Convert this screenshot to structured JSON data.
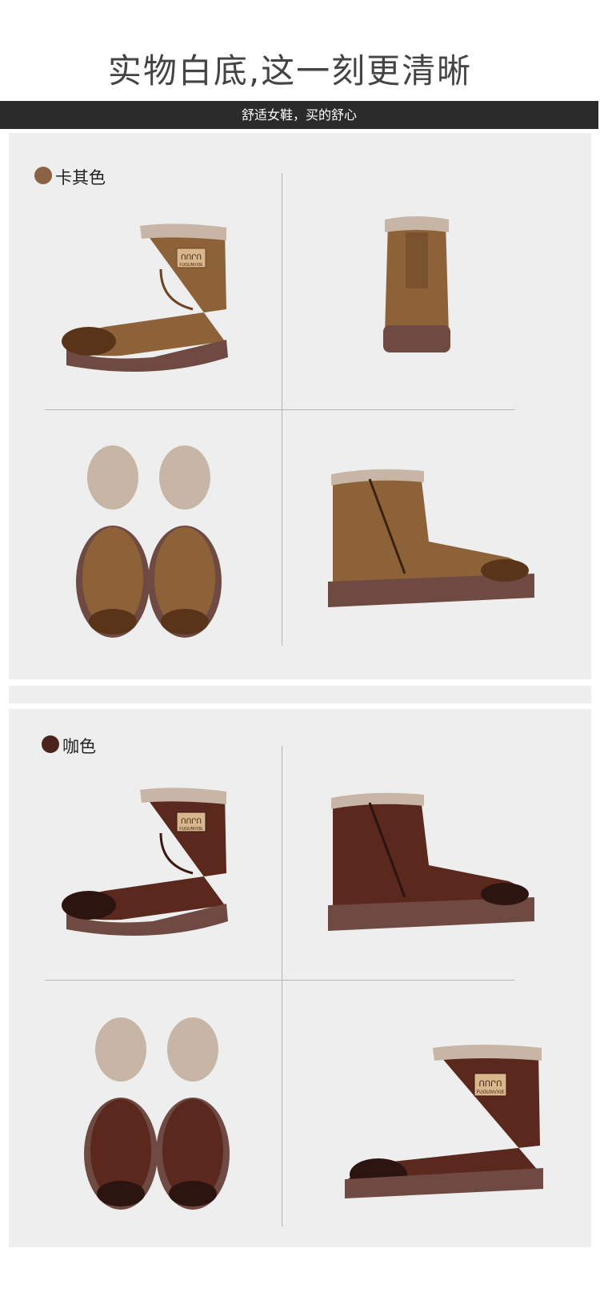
{
  "header": {
    "title": "实物白底,这一刻更清晰",
    "banner": "舒适女鞋，买的舒心"
  },
  "colors": [
    {
      "name": "卡其色",
      "swatch": "#8b6244",
      "upper": "#8e6238",
      "upper_dark": "#6b4422",
      "toe": "#5a3418",
      "sole": "#6e4a42",
      "fur": "#c7b6a5"
    },
    {
      "name": "咖色",
      "swatch": "#4a231c",
      "upper": "#5a281d",
      "upper_dark": "#3c1812",
      "toe": "#2c1410",
      "sole": "#6e4a42",
      "fur": "#c7b6a5"
    }
  ],
  "label_patch": {
    "logo": "ՈՈՐՈ",
    "brand": "FUGUNVXIE"
  }
}
